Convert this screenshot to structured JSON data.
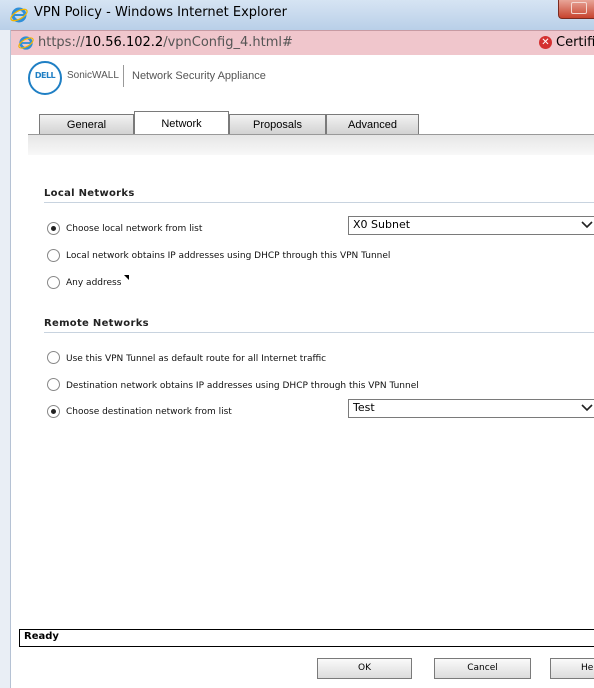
{
  "window": {
    "title": "VPN Policy - Windows Internet Explorer"
  },
  "address": {
    "scheme": "https://",
    "host": "10.56.102.2",
    "path": "/vpnConfig_4.html#",
    "cert_label": "Certific"
  },
  "header": {
    "brand": "SonicWALL",
    "product": "Network Security Appliance",
    "logo_text": "DELL"
  },
  "tabs": [
    {
      "label": "General",
      "active": false
    },
    {
      "label": "Network",
      "active": true
    },
    {
      "label": "Proposals",
      "active": false
    },
    {
      "label": "Advanced",
      "active": false
    }
  ],
  "local": {
    "title": "Local Networks",
    "options": [
      {
        "label": "Choose local network from list",
        "selected": true
      },
      {
        "label": "Local network obtains IP addresses using DHCP through this VPN Tunnel",
        "selected": false
      },
      {
        "label": "Any address",
        "selected": false
      }
    ],
    "select_value": "X0 Subnet"
  },
  "remote": {
    "title": "Remote Networks",
    "options": [
      {
        "label": "Use this VPN Tunnel as default route for all Internet traffic",
        "selected": false
      },
      {
        "label": "Destination network obtains IP addresses using DHCP through this VPN Tunnel",
        "selected": false
      },
      {
        "label": "Choose destination network from list",
        "selected": true
      }
    ],
    "select_value": "Test"
  },
  "status": {
    "text": "Ready"
  },
  "buttons": {
    "ok": "OK",
    "cancel": "Cancel",
    "help": "Help"
  }
}
